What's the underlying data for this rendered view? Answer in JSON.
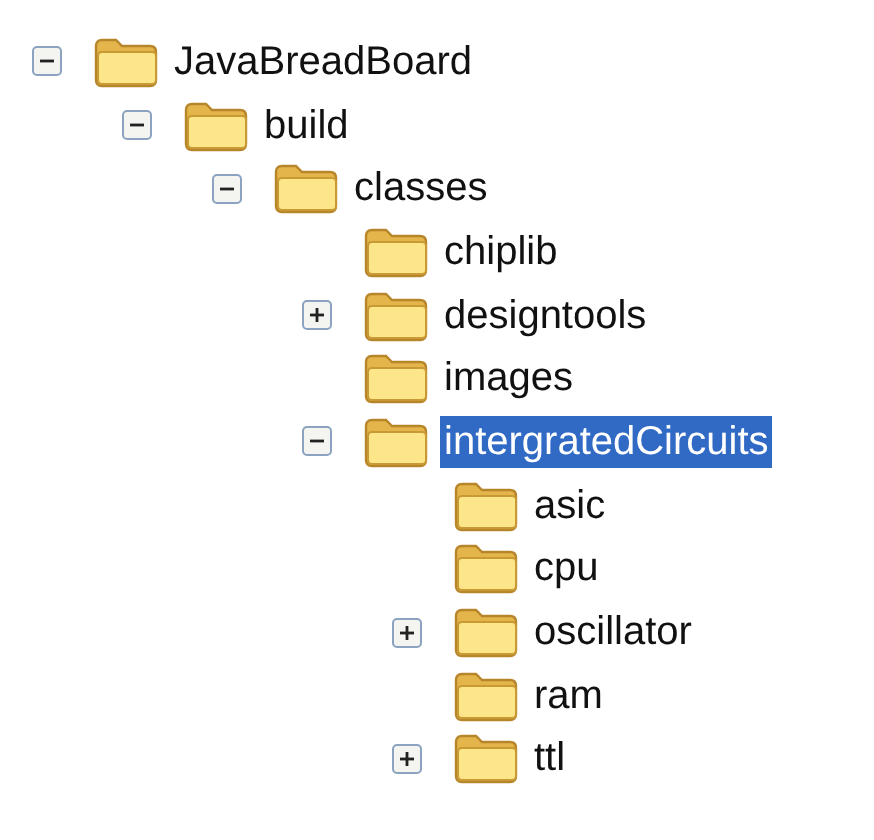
{
  "tree": [
    {
      "label": "JavaBreadBoard",
      "expanded": true,
      "selected": false,
      "children": [
        {
          "label": "build",
          "expanded": true,
          "selected": false,
          "children": [
            {
              "label": "classes",
              "expanded": true,
              "selected": false,
              "children": [
                {
                  "label": "chiplib",
                  "selected": false
                },
                {
                  "label": "designtools",
                  "expanded": false,
                  "selected": false
                },
                {
                  "label": "images",
                  "selected": false
                },
                {
                  "label": "intergratedCircuits",
                  "expanded": true,
                  "selected": true,
                  "children": [
                    {
                      "label": "asic",
                      "selected": false
                    },
                    {
                      "label": "cpu",
                      "selected": false
                    },
                    {
                      "label": "oscillator",
                      "expanded": false,
                      "selected": false
                    },
                    {
                      "label": "ram",
                      "selected": false
                    },
                    {
                      "label": "ttl",
                      "expanded": false,
                      "selected": false
                    }
                  ]
                }
              ]
            }
          ]
        }
      ]
    }
  ]
}
